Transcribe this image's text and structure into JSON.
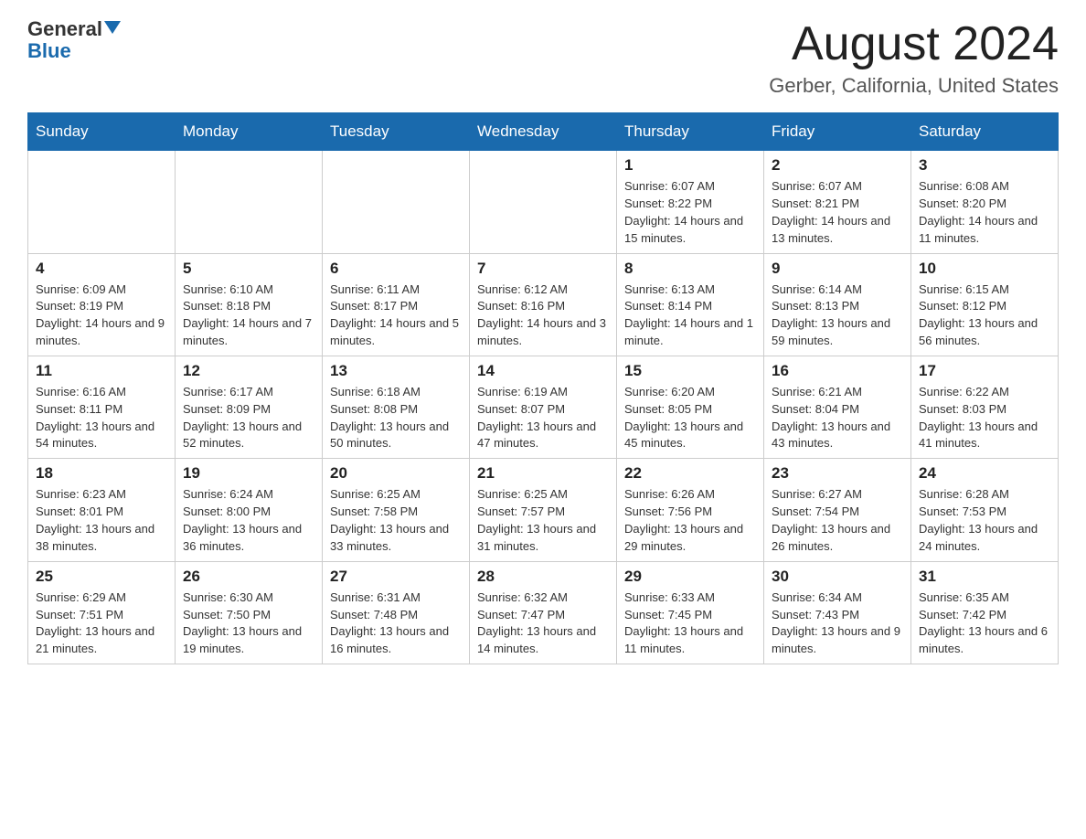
{
  "logo": {
    "general": "General",
    "blue": "Blue"
  },
  "header": {
    "title": "August 2024",
    "location": "Gerber, California, United States"
  },
  "weekdays": [
    "Sunday",
    "Monday",
    "Tuesday",
    "Wednesday",
    "Thursday",
    "Friday",
    "Saturday"
  ],
  "weeks": [
    [
      {
        "day": "",
        "info": ""
      },
      {
        "day": "",
        "info": ""
      },
      {
        "day": "",
        "info": ""
      },
      {
        "day": "",
        "info": ""
      },
      {
        "day": "1",
        "info": "Sunrise: 6:07 AM\nSunset: 8:22 PM\nDaylight: 14 hours and 15 minutes."
      },
      {
        "day": "2",
        "info": "Sunrise: 6:07 AM\nSunset: 8:21 PM\nDaylight: 14 hours and 13 minutes."
      },
      {
        "day": "3",
        "info": "Sunrise: 6:08 AM\nSunset: 8:20 PM\nDaylight: 14 hours and 11 minutes."
      }
    ],
    [
      {
        "day": "4",
        "info": "Sunrise: 6:09 AM\nSunset: 8:19 PM\nDaylight: 14 hours and 9 minutes."
      },
      {
        "day": "5",
        "info": "Sunrise: 6:10 AM\nSunset: 8:18 PM\nDaylight: 14 hours and 7 minutes."
      },
      {
        "day": "6",
        "info": "Sunrise: 6:11 AM\nSunset: 8:17 PM\nDaylight: 14 hours and 5 minutes."
      },
      {
        "day": "7",
        "info": "Sunrise: 6:12 AM\nSunset: 8:16 PM\nDaylight: 14 hours and 3 minutes."
      },
      {
        "day": "8",
        "info": "Sunrise: 6:13 AM\nSunset: 8:14 PM\nDaylight: 14 hours and 1 minute."
      },
      {
        "day": "9",
        "info": "Sunrise: 6:14 AM\nSunset: 8:13 PM\nDaylight: 13 hours and 59 minutes."
      },
      {
        "day": "10",
        "info": "Sunrise: 6:15 AM\nSunset: 8:12 PM\nDaylight: 13 hours and 56 minutes."
      }
    ],
    [
      {
        "day": "11",
        "info": "Sunrise: 6:16 AM\nSunset: 8:11 PM\nDaylight: 13 hours and 54 minutes."
      },
      {
        "day": "12",
        "info": "Sunrise: 6:17 AM\nSunset: 8:09 PM\nDaylight: 13 hours and 52 minutes."
      },
      {
        "day": "13",
        "info": "Sunrise: 6:18 AM\nSunset: 8:08 PM\nDaylight: 13 hours and 50 minutes."
      },
      {
        "day": "14",
        "info": "Sunrise: 6:19 AM\nSunset: 8:07 PM\nDaylight: 13 hours and 47 minutes."
      },
      {
        "day": "15",
        "info": "Sunrise: 6:20 AM\nSunset: 8:05 PM\nDaylight: 13 hours and 45 minutes."
      },
      {
        "day": "16",
        "info": "Sunrise: 6:21 AM\nSunset: 8:04 PM\nDaylight: 13 hours and 43 minutes."
      },
      {
        "day": "17",
        "info": "Sunrise: 6:22 AM\nSunset: 8:03 PM\nDaylight: 13 hours and 41 minutes."
      }
    ],
    [
      {
        "day": "18",
        "info": "Sunrise: 6:23 AM\nSunset: 8:01 PM\nDaylight: 13 hours and 38 minutes."
      },
      {
        "day": "19",
        "info": "Sunrise: 6:24 AM\nSunset: 8:00 PM\nDaylight: 13 hours and 36 minutes."
      },
      {
        "day": "20",
        "info": "Sunrise: 6:25 AM\nSunset: 7:58 PM\nDaylight: 13 hours and 33 minutes."
      },
      {
        "day": "21",
        "info": "Sunrise: 6:25 AM\nSunset: 7:57 PM\nDaylight: 13 hours and 31 minutes."
      },
      {
        "day": "22",
        "info": "Sunrise: 6:26 AM\nSunset: 7:56 PM\nDaylight: 13 hours and 29 minutes."
      },
      {
        "day": "23",
        "info": "Sunrise: 6:27 AM\nSunset: 7:54 PM\nDaylight: 13 hours and 26 minutes."
      },
      {
        "day": "24",
        "info": "Sunrise: 6:28 AM\nSunset: 7:53 PM\nDaylight: 13 hours and 24 minutes."
      }
    ],
    [
      {
        "day": "25",
        "info": "Sunrise: 6:29 AM\nSunset: 7:51 PM\nDaylight: 13 hours and 21 minutes."
      },
      {
        "day": "26",
        "info": "Sunrise: 6:30 AM\nSunset: 7:50 PM\nDaylight: 13 hours and 19 minutes."
      },
      {
        "day": "27",
        "info": "Sunrise: 6:31 AM\nSunset: 7:48 PM\nDaylight: 13 hours and 16 minutes."
      },
      {
        "day": "28",
        "info": "Sunrise: 6:32 AM\nSunset: 7:47 PM\nDaylight: 13 hours and 14 minutes."
      },
      {
        "day": "29",
        "info": "Sunrise: 6:33 AM\nSunset: 7:45 PM\nDaylight: 13 hours and 11 minutes."
      },
      {
        "day": "30",
        "info": "Sunrise: 6:34 AM\nSunset: 7:43 PM\nDaylight: 13 hours and 9 minutes."
      },
      {
        "day": "31",
        "info": "Sunrise: 6:35 AM\nSunset: 7:42 PM\nDaylight: 13 hours and 6 minutes."
      }
    ]
  ]
}
